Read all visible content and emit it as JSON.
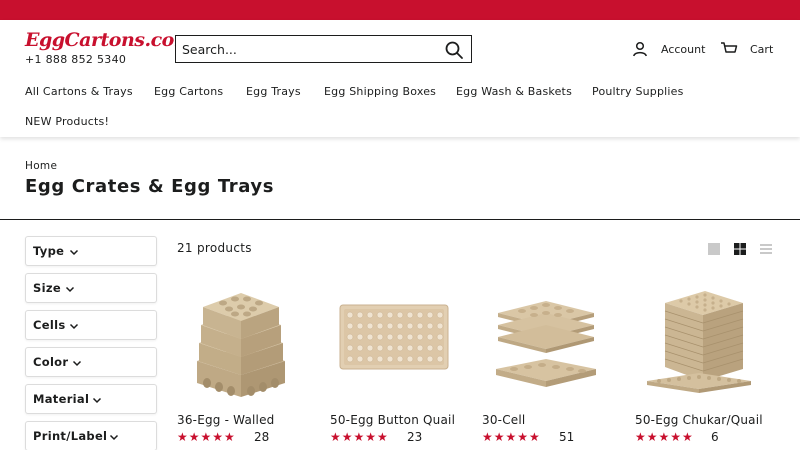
{
  "brand": {
    "logo": "EggCartons.com",
    "logo_mark": "®",
    "phone": "+1 888 852 5340",
    "accent": "#c8102e"
  },
  "search": {
    "placeholder": "Search..."
  },
  "header": {
    "account_label": "Account",
    "cart_label": "Cart"
  },
  "nav": [
    {
      "label": "All Cartons & Trays"
    },
    {
      "label": "Egg Cartons"
    },
    {
      "label": "Egg Trays"
    },
    {
      "label": "Egg Shipping Boxes"
    },
    {
      "label": "Egg Wash & Baskets"
    },
    {
      "label": "Poultry Supplies"
    },
    {
      "label": "NEW Products!"
    }
  ],
  "breadcrumb": "Home",
  "page_title": "Egg Crates & Egg Trays",
  "filters": [
    {
      "label": "Type"
    },
    {
      "label": "Size"
    },
    {
      "label": "Cells"
    },
    {
      "label": "Color"
    },
    {
      "label": "Material"
    },
    {
      "label": "Print/Label"
    }
  ],
  "product_count": "21 products",
  "products": [
    {
      "name": "36-Egg - Walled",
      "stars": "★★★★★",
      "reviews": "28"
    },
    {
      "name": "50-Egg Button Quail",
      "stars": "★★★★★",
      "reviews": "23"
    },
    {
      "name": "30-Cell",
      "stars": "★★★★★",
      "reviews": "51"
    },
    {
      "name": "50-Egg Chukar/Quail",
      "stars": "★★★★★",
      "reviews": "6"
    }
  ]
}
